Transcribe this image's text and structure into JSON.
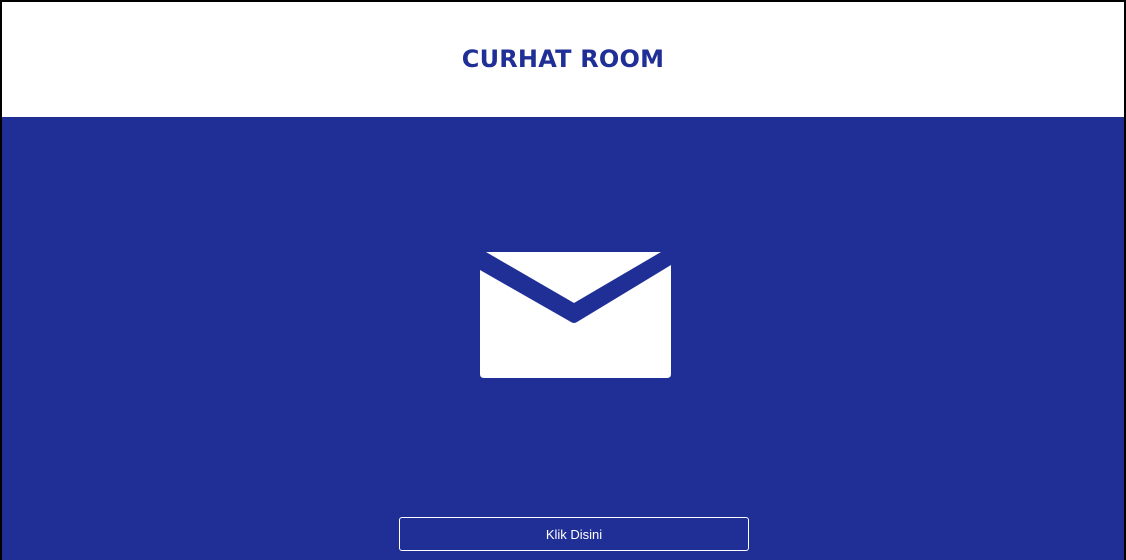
{
  "header": {
    "title": "CURHAT ROOM"
  },
  "main": {
    "icon": "envelope-icon",
    "button_label": "Klik Disini"
  },
  "colors": {
    "brand_blue": "#1f2f96",
    "header_bg": "#ffffff",
    "icon_fill": "#ffffff"
  }
}
